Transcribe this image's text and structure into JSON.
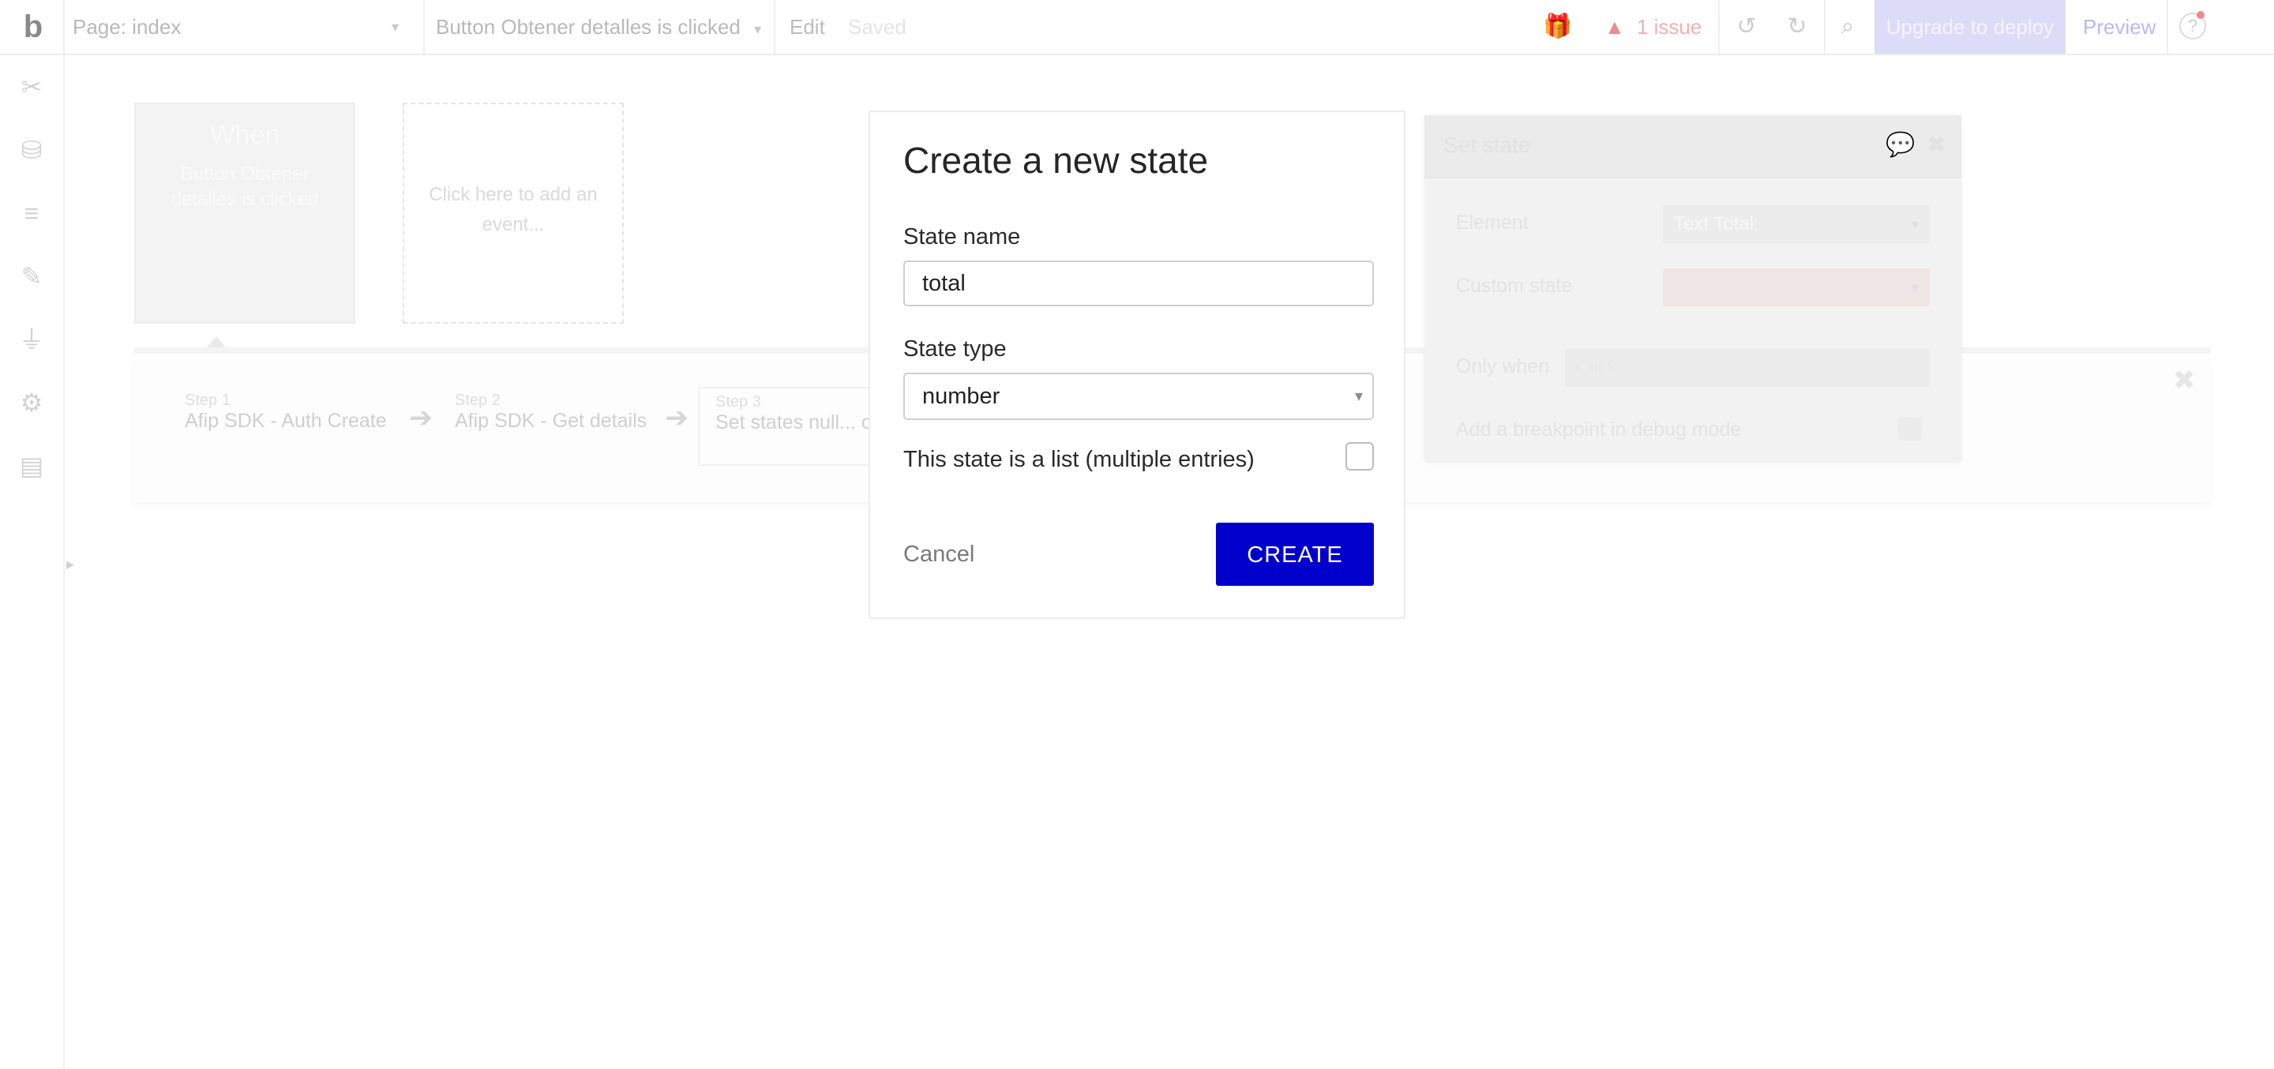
{
  "topbar": {
    "logo": "b",
    "page_selector": "Page: index",
    "workflow_selector": "Button Obtener detalles is clicked",
    "edit_label": "Edit",
    "saved_label": "Saved",
    "issues_label": "1 issue",
    "upgrade_label": "Upgrade to deploy",
    "preview_label": "Preview"
  },
  "workflow": {
    "when_title": "When",
    "when_event": "Button Obtener detalles is clicked",
    "add_event": "Click here to add an event...",
    "steps": [
      {
        "label": "Step 1",
        "name": "Afip SDK - Auth Create"
      },
      {
        "label": "Step 2",
        "name": "Afip SDK - Get details"
      },
      {
        "label": "Step 3",
        "name": "Set states null... o"
      }
    ]
  },
  "set_state_panel": {
    "title": "Set state",
    "element_label": "Element",
    "element_value": "Text Total:",
    "custom_state_label": "Custom state",
    "only_when_label": "Only when",
    "only_when_placeholder": "Click",
    "breakpoint_label": "Add a breakpoint in debug mode"
  },
  "modal": {
    "title": "Create a new state",
    "state_name_label": "State name",
    "state_name_value": "total",
    "state_type_label": "State type",
    "state_type_value": "number",
    "list_label": "This state is a list (multiple entries)",
    "list_checked": false,
    "cancel_label": "Cancel",
    "create_label": "CREATE"
  },
  "colors": {
    "primary": "#0000cc",
    "upgrade_bg": "#dcdcf8",
    "issue_red": "#f08a8a"
  }
}
